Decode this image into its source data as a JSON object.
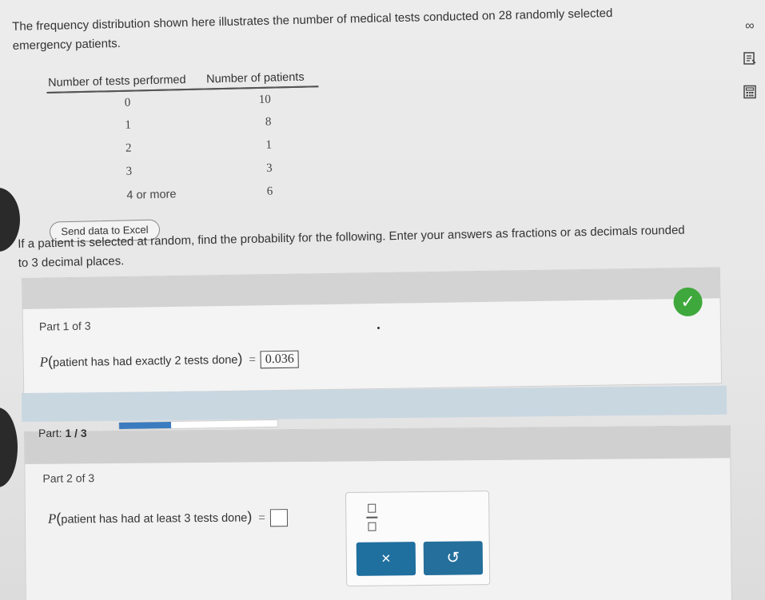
{
  "intro_text": "The frequency distribution shown here illustrates the number of medical tests conducted on 28 randomly selected emergency patients.",
  "table": {
    "headers": [
      "Number of tests performed",
      "Number of patients"
    ],
    "rows": [
      {
        "tests": "0",
        "patients": "10"
      },
      {
        "tests": "1",
        "patients": "8"
      },
      {
        "tests": "2",
        "patients": "1"
      },
      {
        "tests": "3",
        "patients": "3"
      },
      {
        "tests": "4 or more",
        "patients": "6"
      }
    ]
  },
  "excel_button_label": "Send data to Excel",
  "instruction_text": "If a patient is selected at random, find the probability for the following. Enter your answers as fractions or as decimals rounded to 3 decimal places.",
  "part1": {
    "label": "Part 1 of 3",
    "p": "P",
    "question": "patient has had exactly 2 tests done",
    "equals": "=",
    "answer": "0.036",
    "status_icon": "check-icon"
  },
  "part_indicator": {
    "prefix": "Part: ",
    "value": "1 / 3",
    "progress_fraction": 0.33
  },
  "part2": {
    "label": "Part 2 of 3",
    "p": "P",
    "question": "patient has had at least 3 tests done",
    "equals": "=",
    "answer": ""
  },
  "keypad": {
    "fraction_icon": "fraction-icon",
    "clear_symbol": "×",
    "undo_symbol": "↺"
  },
  "side_icons": [
    "infinity-icon",
    "notes-icon",
    "calculator-icon"
  ],
  "colors": {
    "check_green": "#3fa83c",
    "keypad_blue": "#1f6f9f",
    "progress_blue": "#3b7bbf"
  }
}
